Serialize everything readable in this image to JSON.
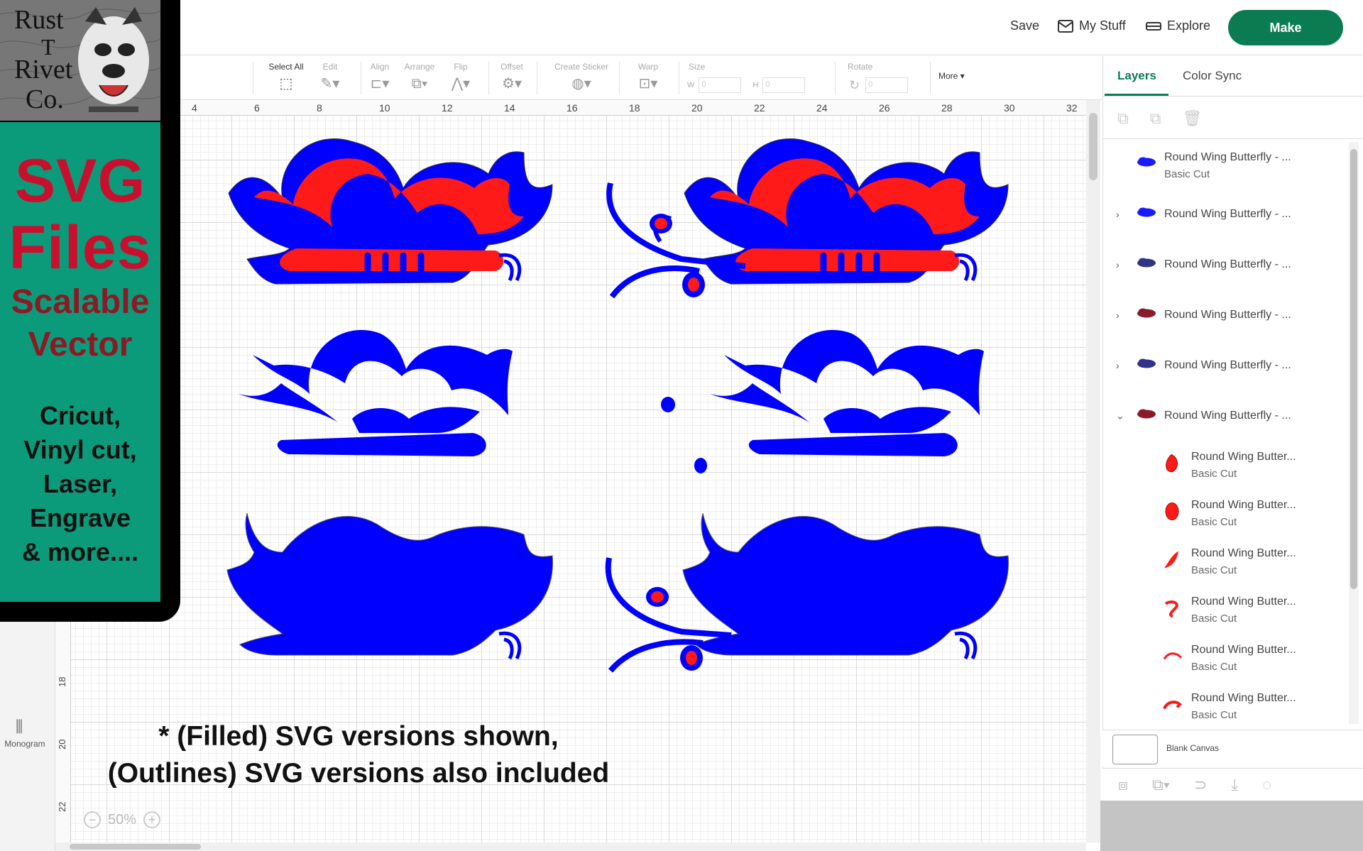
{
  "header": {
    "save_label": "Save",
    "mystuff_label": "My Stuff",
    "explore_label": "Explore",
    "make_label": "Make"
  },
  "toolbar": {
    "select_all": "Select All",
    "edit": "Edit",
    "align": "Align",
    "arrange": "Arrange",
    "flip": "Flip",
    "offset": "Offset",
    "create_sticker": "Create Sticker",
    "warp": "Warp",
    "size": "Size",
    "rotate": "Rotate",
    "more": "More ▾",
    "w_label": "W",
    "h_label": "H",
    "w_value": "0",
    "h_value": "0",
    "rotate_value": "0"
  },
  "ruler": {
    "h_ticks": [
      "4",
      "6",
      "8",
      "10",
      "12",
      "14",
      "16",
      "18",
      "20",
      "22",
      "24",
      "26",
      "28",
      "30",
      "32"
    ],
    "v_ticks": [
      "18",
      "20",
      "22"
    ]
  },
  "leftbar": {
    "monogram_label": "Monogram"
  },
  "zoom": {
    "level": "50%"
  },
  "canvas_note": {
    "line1": "* (Filled) SVG versions shown,",
    "line2": "(Outlines) SVG versions also included"
  },
  "promo": {
    "logo_r1": "Rust",
    "logo_r2": "T",
    "logo_r3": "Rivet",
    "logo_r4": "Co.",
    "svg_line1": "SVG",
    "svg_line2": "Files",
    "scal_line1": "Scalable",
    "scal_line2": "Vector",
    "list": [
      "Cricut,",
      "Vinyl cut,",
      "Laser,",
      "Engrave",
      "& more...."
    ]
  },
  "panel": {
    "tab_layers": "Layers",
    "tab_colorsync": "Color Sync",
    "layers": [
      {
        "name": "Round Wing Butterfly - ...",
        "sub": "Basic Cut",
        "chevron": "",
        "thumb": "blue"
      },
      {
        "name": "Round Wing Butterfly - ...",
        "sub": "",
        "chevron": "›",
        "thumb": "blue"
      },
      {
        "name": "Round Wing Butterfly - ...",
        "sub": "",
        "chevron": "›",
        "thumb": "navy"
      },
      {
        "name": "Round Wing Butterfly - ...",
        "sub": "",
        "chevron": "›",
        "thumb": "red"
      },
      {
        "name": "Round Wing Butterfly - ...",
        "sub": "",
        "chevron": "›",
        "thumb": "navy"
      },
      {
        "name": "Round Wing Butterfly - ...",
        "sub": "",
        "chevron": "⌄",
        "thumb": "red"
      }
    ],
    "children": [
      {
        "name": "Round Wing Butter...",
        "sub": "Basic Cut",
        "shape": "drop"
      },
      {
        "name": "Round Wing Butter...",
        "sub": "Basic Cut",
        "shape": "oval"
      },
      {
        "name": "Round Wing Butter...",
        "sub": "Basic Cut",
        "shape": "leaf"
      },
      {
        "name": "Round Wing Butter...",
        "sub": "Basic Cut",
        "shape": "curl"
      },
      {
        "name": "Round Wing Butter...",
        "sub": "Basic Cut",
        "shape": "arc"
      },
      {
        "name": "Round Wing Butter...",
        "sub": "Basic Cut",
        "shape": "hook"
      }
    ],
    "blank_canvas": "Blank Canvas"
  },
  "colors": {
    "brand_green": "#0b7c52",
    "design_blue": "#0000ff",
    "design_red": "#ff1a1a",
    "promo_green": "#0c9b7a",
    "promo_red": "#c8102e"
  }
}
